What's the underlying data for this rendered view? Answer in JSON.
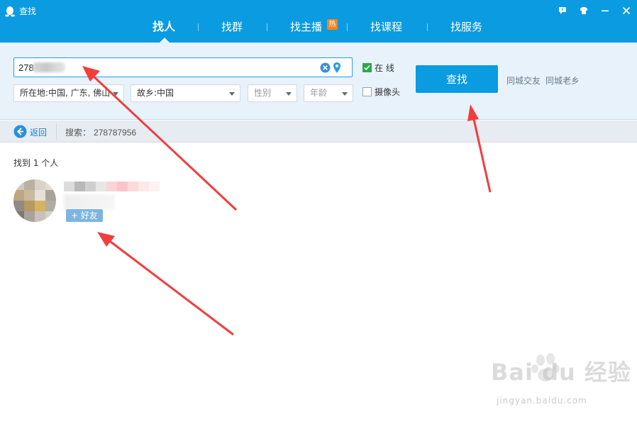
{
  "window": {
    "title": "查找"
  },
  "nav": {
    "tabs": [
      {
        "label": "找人",
        "active": true
      },
      {
        "label": "找群",
        "active": false
      },
      {
        "label": "找主播",
        "active": false,
        "badge": "热"
      },
      {
        "label": "找课程",
        "active": false
      },
      {
        "label": "找服务",
        "active": false
      }
    ]
  },
  "search": {
    "query": "278",
    "location": "所在地:中国, 广东, 佛山",
    "hometown": "故乡:中国",
    "gender": "性别",
    "age": "年龄",
    "online_label": "在  线",
    "online_checked": true,
    "camera_label": "摄像头",
    "camera_checked": false,
    "find_button": "查找",
    "link_local": "同城交友",
    "link_hometown": "同城老乡"
  },
  "results": {
    "back_label": "返回",
    "search_prefix": "搜索：",
    "search_query": "278787956",
    "found_text": "找到 1 个人",
    "add_friend": "+ 好友"
  },
  "watermark": {
    "brand": "Bai du 经验",
    "url": "jingyan.baidu.com"
  },
  "colors": {
    "accent": "#0a9be0",
    "panel": "#e8f2fb",
    "annotation": "#f23d3d"
  }
}
